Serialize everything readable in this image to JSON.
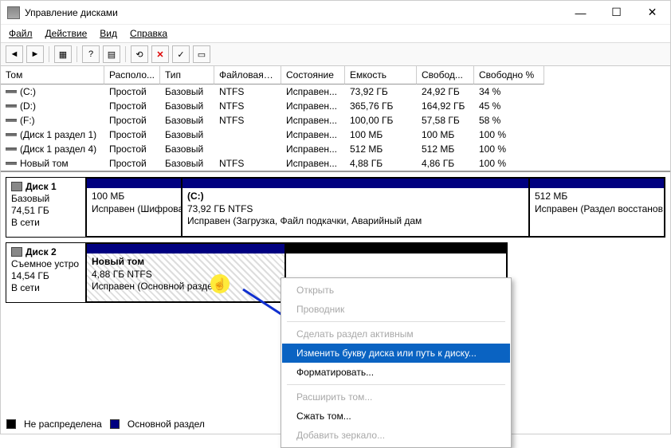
{
  "window": {
    "title": "Управление дисками"
  },
  "menu": {
    "file": "Файл",
    "action": "Действие",
    "view": "Вид",
    "help": "Справка"
  },
  "columns": [
    "Том",
    "Располо...",
    "Тип",
    "Файловая с...",
    "Состояние",
    "Емкость",
    "Свобод...",
    "Свободно %"
  ],
  "rows": [
    {
      "vol": "(C:)",
      "layout": "Простой",
      "type": "Базовый",
      "fs": "NTFS",
      "status": "Исправен...",
      "cap": "73,92 ГБ",
      "free": "24,92 ГБ",
      "pct": "34 %"
    },
    {
      "vol": "(D:)",
      "layout": "Простой",
      "type": "Базовый",
      "fs": "NTFS",
      "status": "Исправен...",
      "cap": "365,76 ГБ",
      "free": "164,92 ГБ",
      "pct": "45 %"
    },
    {
      "vol": "(F:)",
      "layout": "Простой",
      "type": "Базовый",
      "fs": "NTFS",
      "status": "Исправен...",
      "cap": "100,00 ГБ",
      "free": "57,58 ГБ",
      "pct": "58 %"
    },
    {
      "vol": "(Диск 1 раздел 1)",
      "layout": "Простой",
      "type": "Базовый",
      "fs": "",
      "status": "Исправен...",
      "cap": "100 МБ",
      "free": "100 МБ",
      "pct": "100 %"
    },
    {
      "vol": "(Диск 1 раздел 4)",
      "layout": "Простой",
      "type": "Базовый",
      "fs": "",
      "status": "Исправен...",
      "cap": "512 МБ",
      "free": "512 МБ",
      "pct": "100 %"
    },
    {
      "vol": "Новый том",
      "layout": "Простой",
      "type": "Базовый",
      "fs": "NTFS",
      "status": "Исправен...",
      "cap": "4,88 ГБ",
      "free": "4,86 ГБ",
      "pct": "100 %"
    }
  ],
  "disk1": {
    "name": "Диск 1",
    "type": "Базовый",
    "size": "74,51 ГБ",
    "status": "В сети",
    "p1": {
      "size": "100 МБ",
      "status": "Исправен (Шифрова"
    },
    "p2": {
      "label": "(C:)",
      "size": "73,92 ГБ NTFS",
      "status": "Исправен (Загрузка, Файл подкачки, Аварийный дам"
    },
    "p3": {
      "size": "512 МБ",
      "status": "Исправен (Раздел восстанов."
    }
  },
  "disk2": {
    "name": "Диск 2",
    "type": "Съемное устро",
    "size": "14,54 ГБ",
    "status": "В сети",
    "p1": {
      "label": "Новый том",
      "size": "4,88 ГБ NTFS",
      "status": "Исправен (Основной раздел)"
    }
  },
  "legend": {
    "unalloc": "Не распределена",
    "primary": "Основной раздел"
  },
  "ctx": {
    "open": "Открыть",
    "explorer": "Проводник",
    "active": "Сделать раздел активным",
    "changeletter": "Изменить букву диска или путь к диску...",
    "format": "Форматировать...",
    "extend": "Расширить том...",
    "shrink": "Сжать том...",
    "mirror": "Добавить зеркало..."
  }
}
